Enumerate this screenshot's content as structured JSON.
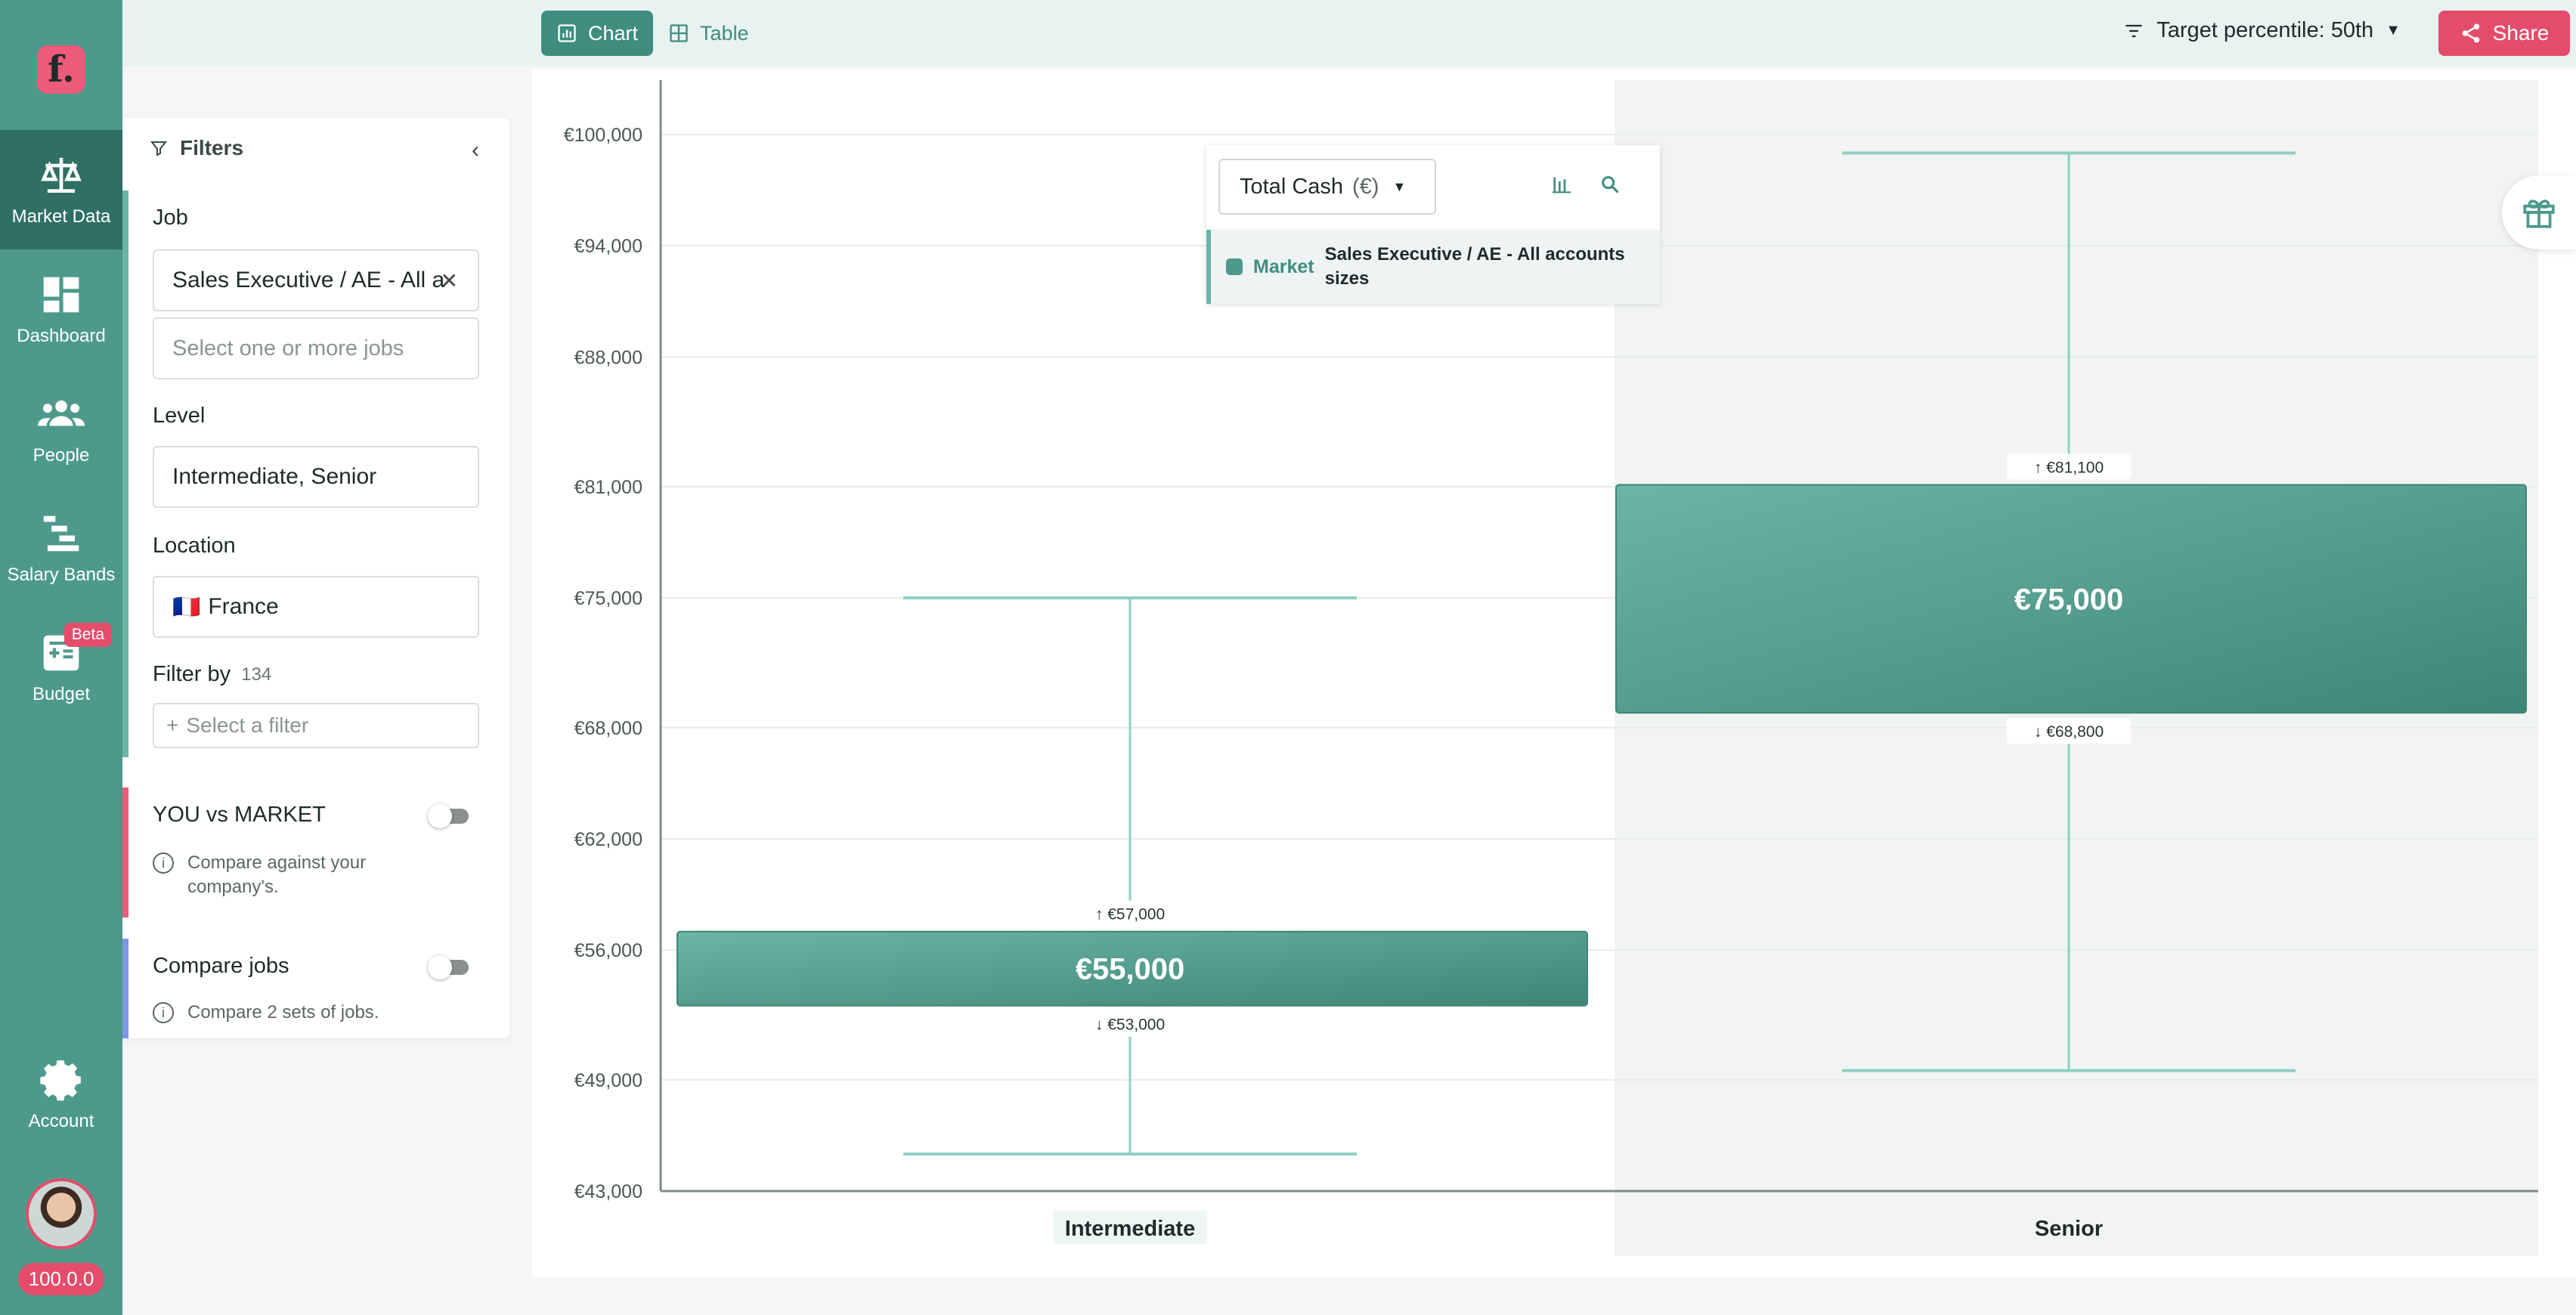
{
  "app": {
    "logo_text": "f.",
    "version": "100.0.0"
  },
  "nav": {
    "items": [
      {
        "label": "Market Data",
        "icon": "scale-icon"
      },
      {
        "label": "Dashboard",
        "icon": "dashboard-icon"
      },
      {
        "label": "People",
        "icon": "people-icon"
      },
      {
        "label": "Salary Bands",
        "icon": "salary-bands-icon"
      },
      {
        "label": "Budget",
        "icon": "budget-icon",
        "badge": "Beta"
      }
    ],
    "account_label": "Account"
  },
  "topbar": {
    "chart_tab": "Chart",
    "table_tab": "Table",
    "percentile_label": "Target percentile: 50th",
    "share_label": "Share"
  },
  "filters": {
    "title": "Filters",
    "job_label": "Job",
    "job_value": "Sales Executive / AE - All a",
    "job_placeholder": "Select one or more jobs",
    "level_label": "Level",
    "level_value": "Intermediate, Senior",
    "location_label": "Location",
    "location_flag": "🇫🇷",
    "location_value": "France",
    "filter_by_label": "Filter by",
    "filter_by_count": "134",
    "filter_placeholder": "Select a filter",
    "you_vs_market_label": "YOU vs MARKET",
    "you_vs_market_info": "Compare against your company's.",
    "compare_jobs_label": "Compare jobs",
    "compare_jobs_info": "Compare 2 sets of jobs."
  },
  "chart_controls": {
    "metric_label": "Total Cash",
    "metric_unit": "(€)",
    "legend_market": "Market",
    "legend_job": "Sales Executive / AE - All accounts sizes"
  },
  "colors": {
    "primary": "#4d9a8c",
    "primary_dark": "#2f6f64",
    "accent": "#e34d6b",
    "bar_top": "#6bb5a6",
    "bar_bottom": "#3f8576"
  },
  "chart_data": {
    "type": "bar",
    "ylim": [
      43000,
      100000
    ],
    "y_ticks": [
      {
        "value": 43000,
        "label": "€43,000"
      },
      {
        "value": 49000,
        "label": "€49,000"
      },
      {
        "value": 56000,
        "label": "€56,000"
      },
      {
        "value": 62000,
        "label": "€62,000"
      },
      {
        "value": 68000,
        "label": "€68,000"
      },
      {
        "value": 75000,
        "label": "€75,000"
      },
      {
        "value": 81000,
        "label": "€81,000"
      },
      {
        "value": 88000,
        "label": "€88,000"
      },
      {
        "value": 94000,
        "label": "€94,000"
      },
      {
        "value": 100000,
        "label": "€100,000"
      }
    ],
    "categories": [
      "Intermediate",
      "Senior"
    ],
    "series": [
      {
        "name": "Market",
        "median": [
          55000,
          75000
        ],
        "median_labels": [
          "€55,000",
          "€75,000"
        ],
        "upper": [
          57000,
          81100
        ],
        "upper_labels": [
          "€57,000",
          "€81,100"
        ],
        "lower": [
          53000,
          68800
        ],
        "lower_labels": [
          "€53,000",
          "€68,800"
        ],
        "whisker_high": [
          75000,
          99000
        ],
        "whisker_low": [
          45000,
          49500
        ]
      }
    ]
  }
}
